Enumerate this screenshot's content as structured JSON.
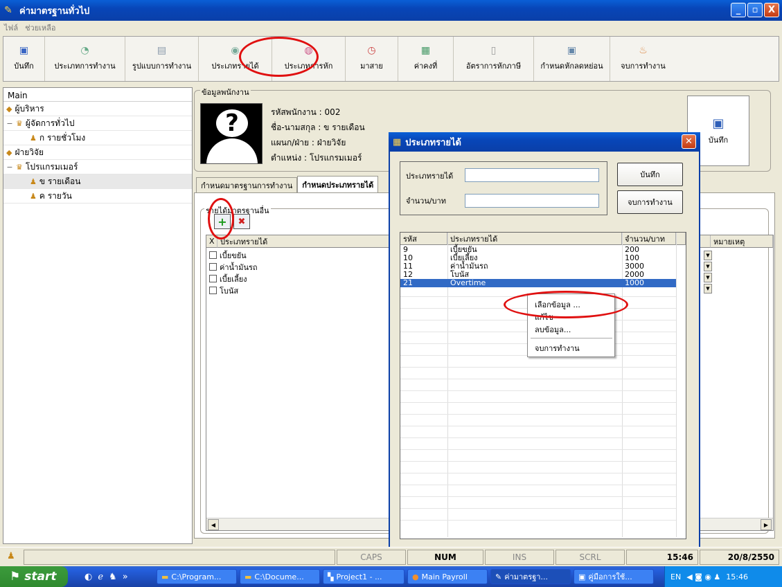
{
  "window": {
    "title": "ค่ามาตรฐานทั่วไป",
    "buttons": [
      "_",
      "▫",
      "X"
    ]
  },
  "menu": [
    "ไฟล์",
    "ช่วยเหลือ"
  ],
  "toolbar": [
    {
      "label": "บันทึก",
      "icon": "save-icon"
    },
    {
      "label": "ประเภทการทำงาน",
      "icon": "worktype-icon"
    },
    {
      "label": "รูปแบบการทำงาน",
      "icon": "workpattern-icon"
    },
    {
      "label": "ประเภทรายได้",
      "icon": "income-icon"
    },
    {
      "label": "ประเภทการหัก",
      "icon": "deduct-icon"
    },
    {
      "label": "มาสาย",
      "icon": "late-icon"
    },
    {
      "label": "ค่าคงที่",
      "icon": "constant-icon"
    },
    {
      "label": "อัตราการหักภาษี",
      "icon": "tax-icon"
    },
    {
      "label": "กำหนดหักลดหย่อน",
      "icon": "allowance-icon"
    },
    {
      "label": "จบการทำงาน",
      "icon": "exit-icon"
    }
  ],
  "tree": {
    "header": "Main",
    "items": [
      {
        "label": "ผู้บริหาร",
        "level": 0,
        "expander": ""
      },
      {
        "label": "ผู้จัดการทั่วไป",
        "level": 1,
        "expander": "−"
      },
      {
        "label": "ก รายชั่วโมง",
        "level": 2,
        "expander": ""
      },
      {
        "label": "ฝ่ายวิจัย",
        "level": 0,
        "expander": ""
      },
      {
        "label": "โปรแกรมเมอร์",
        "level": 1,
        "expander": "−"
      },
      {
        "label": "ข รายเดือน",
        "level": 2,
        "expander": ""
      },
      {
        "label": "ค รายวัน",
        "level": 2,
        "expander": ""
      }
    ]
  },
  "employee": {
    "legend": "ข้อมูลพนักงาน",
    "id_label": "รหัสพนักงาน :",
    "id": "002",
    "name_label": "ชื่อ-นามสกุล :",
    "name": "ข รายเดือน",
    "dept_label": "แผนก/ฝ่าย :",
    "dept": "ฝ่ายวิจัย",
    "pos_label": "ตำแหน่ง :",
    "pos": "โปรแกรมเมอร์",
    "save": "บันทึก"
  },
  "tabs": [
    "กำหนดมาตรฐานการทำงาน",
    "กำหนดประเภทรายได้"
  ],
  "incomegroup": {
    "legend": "รายได้มาตรฐานอื่น",
    "add": "+",
    "del": "✖",
    "cols": [
      "X",
      "ประเภทรายได้",
      "หมายเหตุ"
    ],
    "rows": [
      "เบี้ยขยัน",
      "ค่าน้ำมันรถ",
      "เบี้ยเลี้ยง",
      "โบนัส"
    ]
  },
  "dialog": {
    "title": "ประเภทรายได้",
    "f1_label": "ประเภทรายได้",
    "f1_value": "",
    "f2_label": "จำนวน/บาท",
    "f2_value": "",
    "save": "บันทึก",
    "exit": "จบการทำงาน",
    "cols": [
      "รหัส",
      "ประเภทรายได้",
      "จำนวน/บาท"
    ],
    "rows": [
      {
        "code": "9",
        "type": "เบี้ยขยัน",
        "amount": "200"
      },
      {
        "code": "10",
        "type": "เบี้ยเลี้ยง",
        "amount": "100"
      },
      {
        "code": "11",
        "type": "ค่าน้ำมันรถ",
        "amount": "3000"
      },
      {
        "code": "12",
        "type": "โบนัส",
        "amount": "2000"
      },
      {
        "code": "21",
        "type": "Overtime",
        "amount": "1000"
      }
    ]
  },
  "context_menu": [
    "เลือกข้อมูล ...",
    "แก้ไข",
    "ลบข้อมูล...",
    "จบการทำงาน"
  ],
  "status": {
    "caps": "CAPS",
    "num": "NUM",
    "ins": "INS",
    "scrl": "SCRL",
    "time": "15:46",
    "date": "20/8/2550"
  },
  "taskbar": {
    "start": "start",
    "tasks": [
      "C:\\Program...",
      "C:\\Docume...",
      "Project1 - ...",
      "Main Payroll",
      "ค่ามาตรฐา...",
      "คู่มือการใช้..."
    ],
    "lang": "EN",
    "clock": "15:46"
  }
}
